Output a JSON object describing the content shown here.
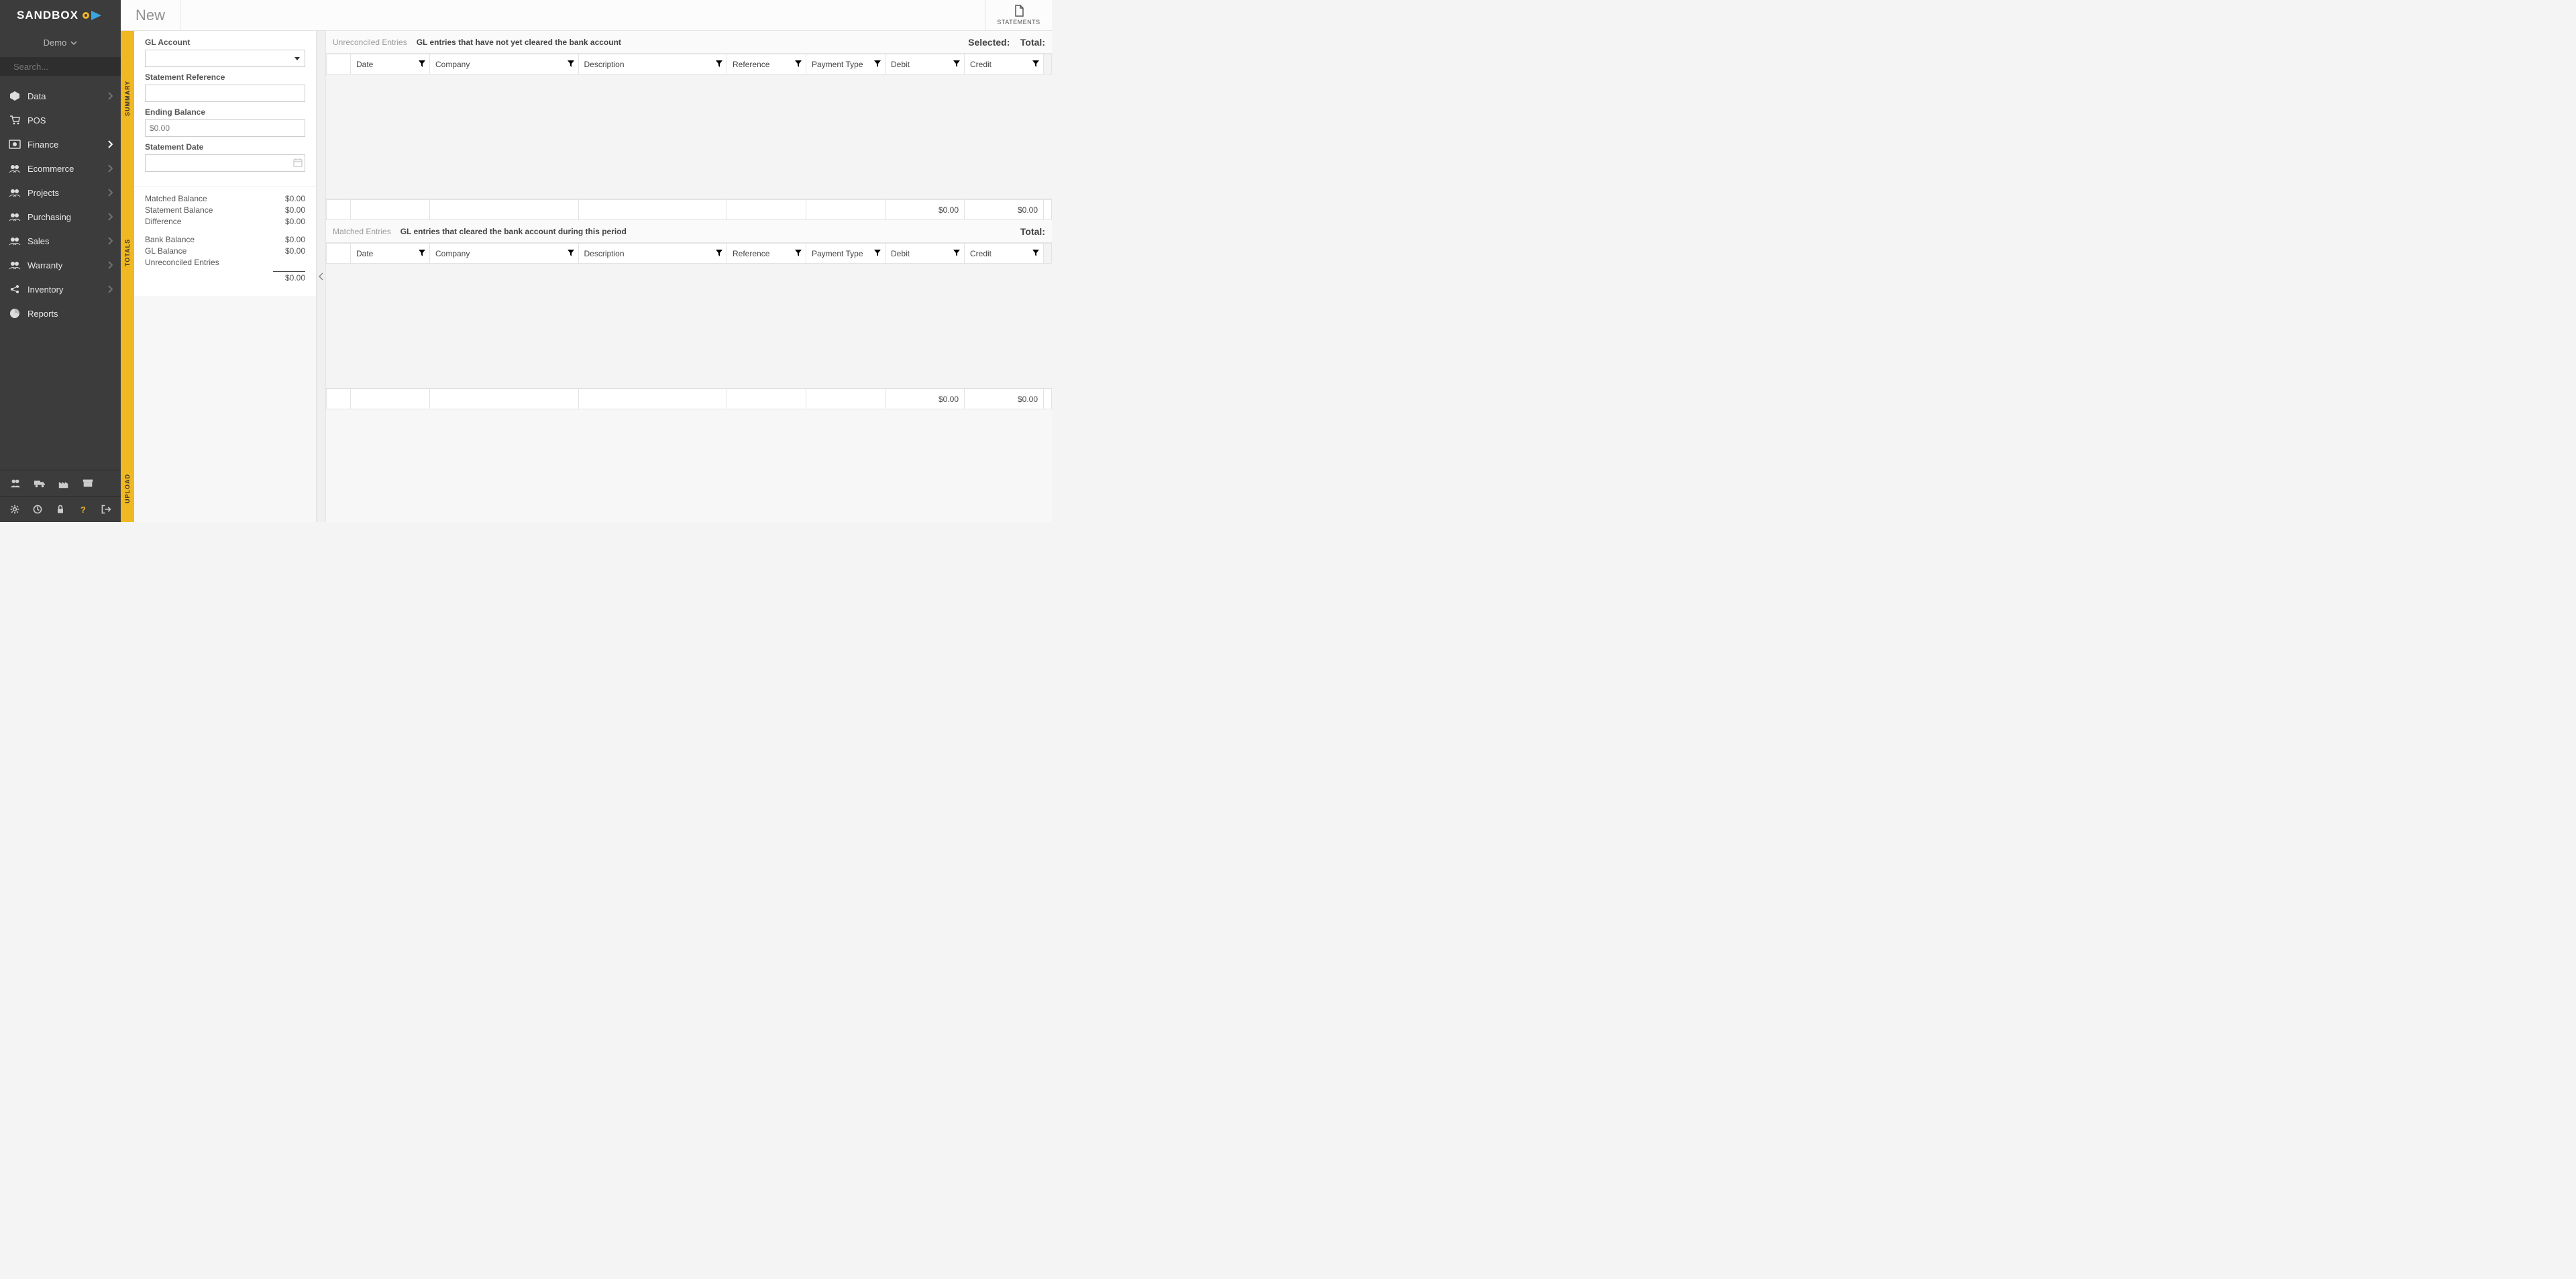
{
  "brand": "SANDBOX",
  "tenant": "Demo",
  "search": {
    "placeholder": "Search..."
  },
  "nav": [
    {
      "label": "Data",
      "icon": "cube"
    },
    {
      "label": "POS",
      "icon": "cart"
    },
    {
      "label": "Finance",
      "icon": "money",
      "active": true
    },
    {
      "label": "Ecommerce",
      "icon": "users"
    },
    {
      "label": "Projects",
      "icon": "users"
    },
    {
      "label": "Purchasing",
      "icon": "users"
    },
    {
      "label": "Sales",
      "icon": "users"
    },
    {
      "label": "Warranty",
      "icon": "users"
    },
    {
      "label": "Inventory",
      "icon": "share"
    },
    {
      "label": "Reports",
      "icon": "pie"
    }
  ],
  "page_title": "New",
  "statements_label": "STATEMENTS",
  "side_tabs": {
    "summary": "SUMMARY",
    "totals": "TOTALS",
    "upload": "UPLOAD"
  },
  "form": {
    "gl_account_label": "GL Account",
    "stmt_ref_label": "Statement Reference",
    "ending_balance_label": "Ending Balance",
    "ending_balance_placeholder": "$0.00",
    "stmt_date_label": "Statement Date"
  },
  "totals": {
    "matched_label": "Matched Balance",
    "matched_value": "$0.00",
    "stmtbal_label": "Statement Balance",
    "stmtbal_value": "$0.00",
    "diff_label": "Difference",
    "diff_value": "$0.00",
    "bank_label": "Bank Balance",
    "bank_value": "$0.00",
    "gl_label": "GL Balance",
    "gl_value": "$0.00",
    "unrec_label": "Unreconciled Entries",
    "sum_value": "$0.00"
  },
  "grids": {
    "unreconciled": {
      "title": "Unreconciled Entries",
      "desc": "GL entries that have not yet cleared the bank account",
      "selected_label": "Selected:",
      "total_label": "Total:",
      "columns": [
        "Date",
        "Company",
        "Description",
        "Reference",
        "Payment Type",
        "Debit",
        "Credit"
      ],
      "footer": {
        "debit": "$0.00",
        "credit": "$0.00"
      }
    },
    "matched": {
      "title": "Matched Entries",
      "desc": "GL entries that cleared the bank account during this period",
      "total_label": "Total:",
      "columns": [
        "Date",
        "Company",
        "Description",
        "Reference",
        "Payment Type",
        "Debit",
        "Credit"
      ],
      "footer": {
        "debit": "$0.00",
        "credit": "$0.00"
      }
    }
  }
}
